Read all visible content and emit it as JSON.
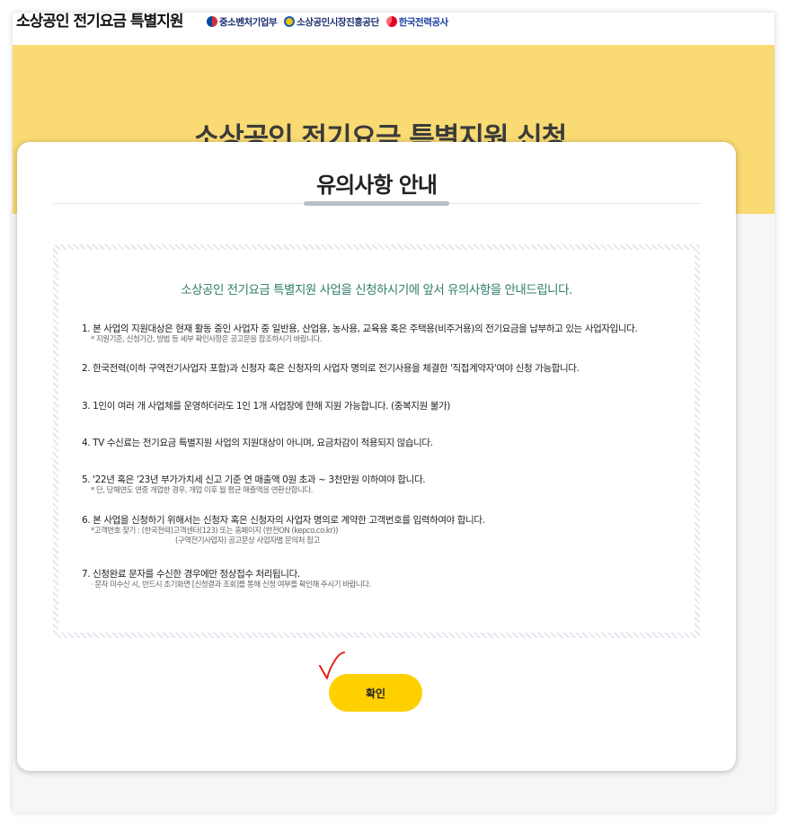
{
  "header": {
    "brand": "소상공인 전기요금 특별지원",
    "orgs": [
      "중소벤처기업부",
      "소상공인시장진흥공단",
      "한국전력공사"
    ]
  },
  "banner": {
    "title": "소상공인 전기요금 특별지원 신청"
  },
  "card": {
    "title": "유의사항 안내",
    "notice_heading": "소상공인 전기요금 특별지원 사업을 신청하시기에 앞서 유의사항을 안내드립니다.",
    "items": [
      {
        "text": "1. 본 사업의 지원대상은 현재 활동 중인 사업자 중 일반용, 산업용, 농사용, 교육용 혹은 주택용(비주거용)의 전기요금을 납부하고 있는 사업자입니다.",
        "sub": "* 지원기준, 신청기간, 방법 등 세부 확인사항은 공고문을 참조하시기 바랍니다."
      },
      {
        "text": "2. 한국전력(이하 구역전기사업자 포함)과 신청자 혹은 신청자의 사업자 명의로 전기사용을 체결한 '직접계약자'여야 신청 가능합니다."
      },
      {
        "text": "3. 1인이 여러 개 사업체를 운영하더라도 1인 1개 사업장에 한해 지원 가능합니다. (중복지원 불가)"
      },
      {
        "text": "4. TV 수신료는 전기요금 특별지원 사업의 지원대상이 아니며, 요금차감이 적용되지 않습니다."
      },
      {
        "text": "5. '22년 혹은 '23년 부가가치세 신고 기준 연 매출액 0원 초과 ~ 3천만원 이하여야 합니다.",
        "sub": "* 단, 당해연도 연중 개업한 경우, 개업 이후 월 평균 매출액을 연환산합니다."
      },
      {
        "text": "6. 본 사업을 신청하기 위해서는 신청자 혹은 신청자의 사업자 명의로 계약한 고객번호를 입력하여야 합니다.",
        "sub": "*고객번호 찾기 : (한국전력)고객센터(123) 또는 홈페이지 (한전ON (kepco.co.kr))",
        "sub2": "(구역전기사업자) 공고문상 사업자별 문의처 참고"
      },
      {
        "text": "7. 신청완료 문자를 수신한 경우에만 정상접수 처리됩니다.",
        "sub": "· 문자 미수신 시, 반드시 초기화면 [신청결과 조회]를 통해 신청 여부를 확인해 주시기 바랍니다."
      }
    ],
    "confirm_label": "확인"
  },
  "colors": {
    "banner": "#f9da73",
    "confirm_button": "#ffd000",
    "notice_heading": "#2f7d6b",
    "check_mark": "#e2231a"
  },
  "icons": {
    "mss_logo": "taegeuk-circle-icon",
    "semas_logo": "semas-logo-icon",
    "kepco_logo": "kepco-logo-icon",
    "annotation": "hand-drawn-check-mark"
  }
}
